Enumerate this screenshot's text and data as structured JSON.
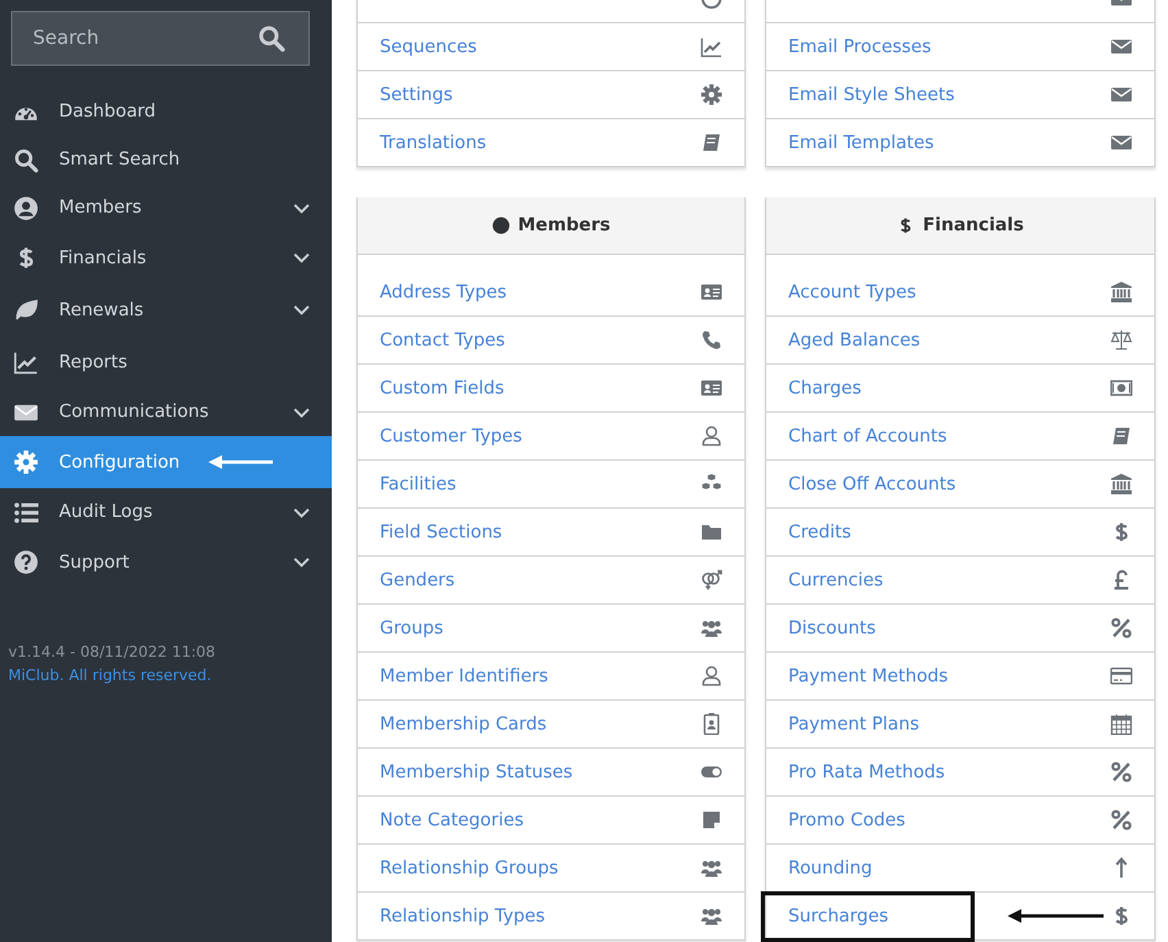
{
  "sidebar": {
    "search": {
      "placeholder": "Search"
    },
    "items": [
      {
        "label": "Dashboard",
        "has_submenu": false,
        "selected": false,
        "annotated": false
      },
      {
        "label": "Smart Search",
        "has_submenu": false,
        "selected": false,
        "annotated": false
      },
      {
        "label": "Members",
        "has_submenu": true,
        "selected": false,
        "annotated": false
      },
      {
        "label": "Financials",
        "has_submenu": true,
        "selected": false,
        "annotated": false
      },
      {
        "label": "Renewals",
        "has_submenu": true,
        "selected": false,
        "annotated": false
      },
      {
        "label": "Reports",
        "has_submenu": false,
        "selected": false,
        "annotated": false
      },
      {
        "label": "Communications",
        "has_submenu": true,
        "selected": false,
        "annotated": false
      },
      {
        "label": "Configuration",
        "has_submenu": false,
        "selected": true,
        "annotated": true
      },
      {
        "label": "Audit Logs",
        "has_submenu": true,
        "selected": false,
        "annotated": false
      },
      {
        "label": "Support",
        "has_submenu": true,
        "selected": false,
        "annotated": false
      }
    ],
    "version": "v1.14.4 - 08/11/2022 11:08",
    "copyright": "MiClub. All rights reserved."
  },
  "panels": [
    {
      "cut_row": true,
      "items": [
        {
          "label": "Sequences",
          "annotated": false
        },
        {
          "label": "Settings",
          "annotated": false
        },
        {
          "label": "Translations",
          "annotated": false
        }
      ]
    },
    {
      "cut_row": true,
      "items": [
        {
          "label": "Email Processes",
          "annotated": false
        },
        {
          "label": "Email Style Sheets",
          "annotated": false
        },
        {
          "label": "Email Templates",
          "annotated": false
        }
      ]
    },
    {
      "title": "Members",
      "items": [
        {
          "label": "Address Types",
          "annotated": false
        },
        {
          "label": "Contact Types",
          "annotated": false
        },
        {
          "label": "Custom Fields",
          "annotated": false
        },
        {
          "label": "Customer Types",
          "annotated": false
        },
        {
          "label": "Facilities",
          "annotated": false
        },
        {
          "label": "Field Sections",
          "annotated": false
        },
        {
          "label": "Genders",
          "annotated": false
        },
        {
          "label": "Groups",
          "annotated": false
        },
        {
          "label": "Member Identifiers",
          "annotated": false
        },
        {
          "label": "Membership Cards",
          "annotated": false
        },
        {
          "label": "Membership Statuses",
          "annotated": false
        },
        {
          "label": "Note Categories",
          "annotated": false
        },
        {
          "label": "Relationship Groups",
          "annotated": false
        },
        {
          "label": "Relationship Types",
          "annotated": false
        }
      ]
    },
    {
      "title": "Financials",
      "items": [
        {
          "label": "Account Types",
          "annotated": false
        },
        {
          "label": "Aged Balances",
          "annotated": false
        },
        {
          "label": "Charges",
          "annotated": false
        },
        {
          "label": "Chart of Accounts",
          "annotated": false
        },
        {
          "label": "Close Off Accounts",
          "annotated": false
        },
        {
          "label": "Credits",
          "annotated": false
        },
        {
          "label": "Currencies",
          "annotated": false
        },
        {
          "label": "Discounts",
          "annotated": false
        },
        {
          "label": "Payment Methods",
          "annotated": false
        },
        {
          "label": "Payment Plans",
          "annotated": false
        },
        {
          "label": "Pro Rata Methods",
          "annotated": false
        },
        {
          "label": "Promo Codes",
          "annotated": false
        },
        {
          "label": "Rounding",
          "annotated": false
        },
        {
          "label": "Surcharges",
          "annotated": true
        }
      ]
    }
  ]
}
